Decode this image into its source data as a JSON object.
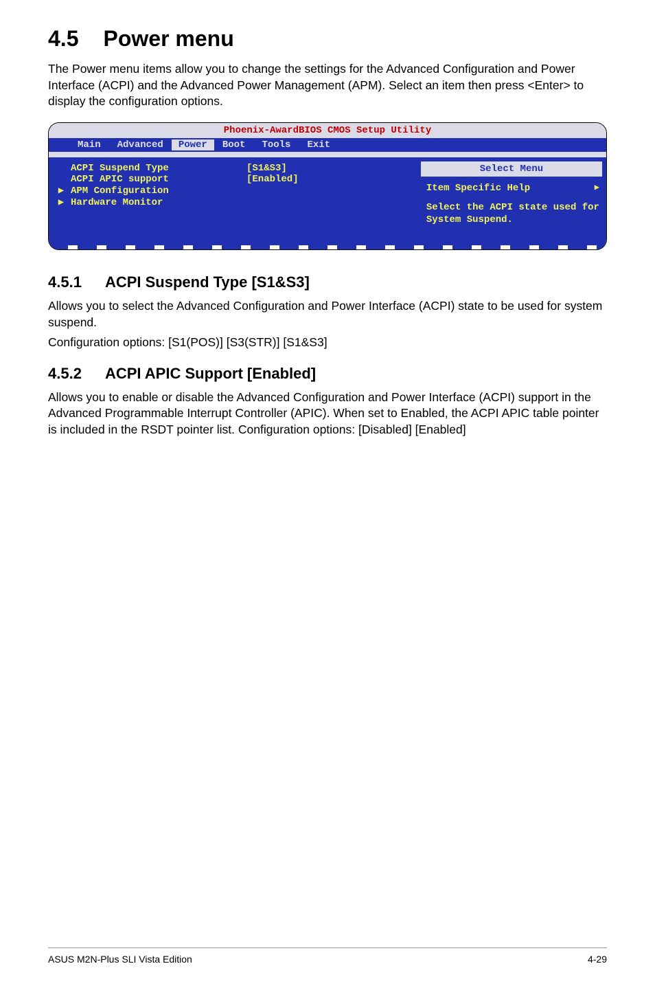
{
  "section": {
    "number": "4.5",
    "title": "Power menu"
  },
  "intro": "The Power menu items allow you to change the settings for the Advanced Configuration and Power Interface (ACPI) and the Advanced Power Management (APM). Select an item then press <Enter> to display the configuration options.",
  "bios": {
    "window_title": "Phoenix-AwardBIOS CMOS Setup Utility",
    "menu": {
      "items": [
        "Main",
        "Advanced",
        "Power",
        "Boot",
        "Tools",
        "Exit"
      ],
      "selected_index": 2
    },
    "left_items": [
      {
        "arrow": "",
        "label": "ACPI Suspend Type",
        "value": "[S1&S3]"
      },
      {
        "arrow": "",
        "label": "ACPI APIC support",
        "value": "[Enabled]"
      },
      {
        "arrow": "▶",
        "label": "APM Configuration",
        "value": ""
      },
      {
        "arrow": "▶",
        "label": "Hardware Monitor",
        "value": ""
      }
    ],
    "right": {
      "select_menu": "Select Menu",
      "help_title": "Item Specific Help",
      "help_body": "Select the ACPI state used for System Suspend."
    }
  },
  "sub1": {
    "number": "4.5.1",
    "title": "ACPI Suspend Type [S1&S3]",
    "p1": "Allows you to select the Advanced Configuration and Power Interface (ACPI) state to be used for system suspend.",
    "p2": "Configuration options: [S1(POS)] [S3(STR)] [S1&S3]"
  },
  "sub2": {
    "number": "4.5.2",
    "title": "ACPI APIC Support [Enabled]",
    "p1": "Allows you to enable or disable the Advanced Configuration and Power Interface (ACPI) support in the Advanced Programmable Interrupt Controller (APIC). When set to Enabled, the ACPI APIC table pointer is included in the RSDT pointer list. Configuration options: [Disabled] [Enabled]"
  },
  "footer": {
    "left": "ASUS M2N-Plus SLI Vista Edition",
    "right": "4-29"
  }
}
